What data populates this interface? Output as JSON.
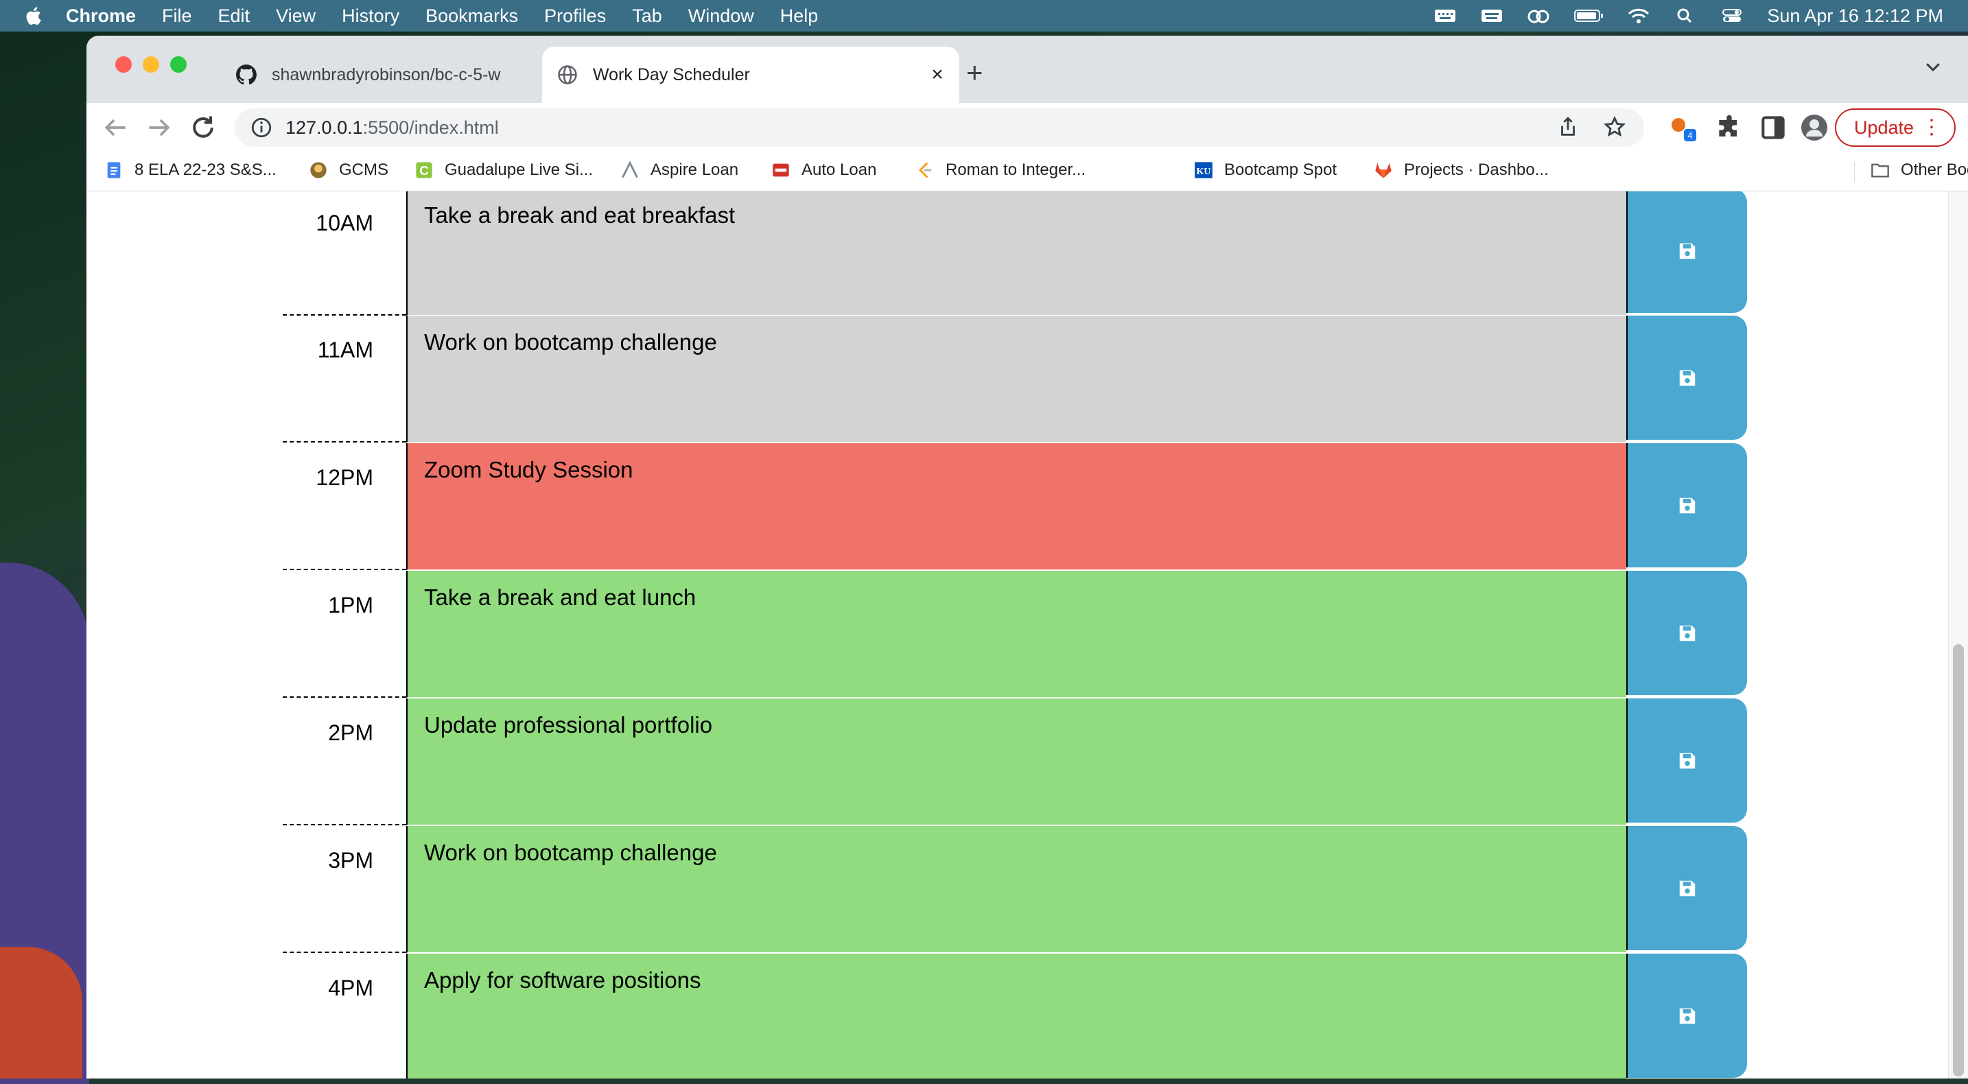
{
  "menubar": {
    "items": [
      "Chrome",
      "File",
      "Edit",
      "View",
      "History",
      "Bookmarks",
      "Profiles",
      "Tab",
      "Window",
      "Help"
    ],
    "clock": "Sun Apr 16  12:12 PM"
  },
  "tabs": [
    {
      "title": "shawnbradyrobinson/bc-c-5-w",
      "icon": "github-icon"
    },
    {
      "title": "Work Day Scheduler",
      "icon": "globe-icon"
    }
  ],
  "toolbar": {
    "url_host": "127.0.0.1",
    "url_rest": ":5500/index.html",
    "update_label": "Update",
    "extension_badge": "4"
  },
  "bookmarks": [
    {
      "label": "8 ELA 22-23 S&S...",
      "icon": "docs-icon",
      "color": "#4285f4"
    },
    {
      "label": "GCMS",
      "icon": "mascot-icon",
      "color": "#8b6d2f"
    },
    {
      "label": "Guadalupe Live Si...",
      "icon": "green-c-icon",
      "color": "#8cc63f"
    },
    {
      "label": "Aspire Loan",
      "icon": "aspire-icon",
      "color": "#7a8a9a"
    },
    {
      "label": "Auto Loan",
      "icon": "autoloan-icon",
      "color": "#d22f27"
    },
    {
      "label": "Roman to Integer...",
      "icon": "leetcode-icon",
      "color": "#f89f1b"
    },
    {
      "label": "Bootcamp Spot",
      "icon": "ku-icon",
      "color": "#0051ba"
    },
    {
      "label": "Projects · Dashbo...",
      "icon": "gitlab-icon",
      "color": "#e24329"
    }
  ],
  "other_bookmarks": "Other Bookmarks",
  "schedule": [
    {
      "hour": "10AM",
      "text": "Take a break and eat breakfast",
      "state": "past"
    },
    {
      "hour": "11AM",
      "text": "Work on bootcamp challenge",
      "state": "past"
    },
    {
      "hour": "12PM",
      "text": "Zoom Study Session",
      "state": "present"
    },
    {
      "hour": "1PM",
      "text": "Take a break and eat lunch",
      "state": "future"
    },
    {
      "hour": "2PM",
      "text": "Update professional portfolio",
      "state": "future"
    },
    {
      "hour": "3PM",
      "text": "Work on bootcamp challenge",
      "state": "future"
    },
    {
      "hour": "4PM",
      "text": "Apply for software positions",
      "state": "future"
    }
  ],
  "colors": {
    "past": "#d3d3d3",
    "present": "#ef7368",
    "future": "#90dc7f",
    "save": "#4aa8d1"
  }
}
